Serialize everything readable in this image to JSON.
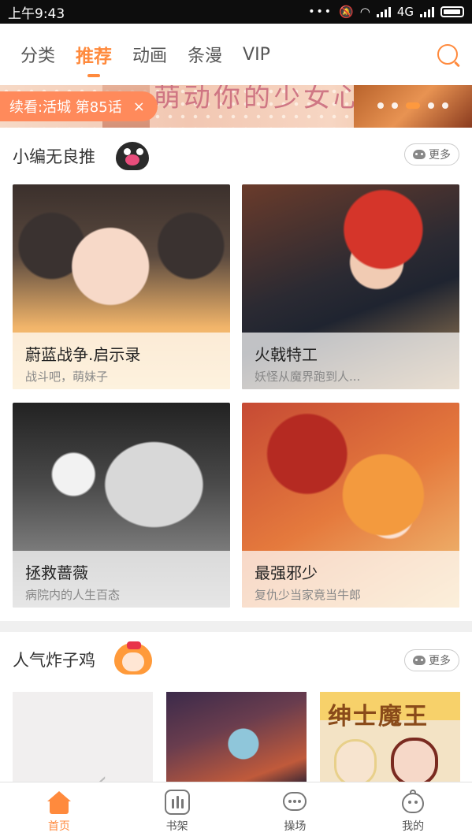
{
  "status_bar": {
    "time": "上午9:43",
    "network": "4G"
  },
  "top_nav": {
    "tabs": [
      {
        "label": "分类"
      },
      {
        "label": "推荐",
        "active": true
      },
      {
        "label": "动画"
      },
      {
        "label": "条漫"
      },
      {
        "label": "VIP"
      }
    ],
    "search_icon": "search-icon"
  },
  "banner": {
    "text": "萌动你的少女心",
    "resume_label": "续看:活城 第85话",
    "close_glyph": "×",
    "page_count": 5,
    "active_page": 3
  },
  "section_recommend": {
    "title": "小编无良推",
    "more_label": "更多",
    "cards": [
      {
        "title": "蔚蓝战争.启示录",
        "subtitle": "战斗吧，萌妹子"
      },
      {
        "title": "火戟特工",
        "subtitle": "妖怪从魔界跑到人..."
      },
      {
        "title": "拯救蔷薇",
        "subtitle": "病院内的人生百态"
      },
      {
        "title": "最强邪少",
        "subtitle": "复仇少当家竟当牛郎"
      }
    ]
  },
  "section_popular": {
    "title": "人气炸子鸡",
    "more_label": "更多",
    "thumb_3_logo": "绅士魔王"
  },
  "bottom_nav": {
    "items": [
      {
        "label": "首页",
        "icon": "home-icon",
        "active": true
      },
      {
        "label": "书架",
        "icon": "bookshelf-icon"
      },
      {
        "label": "操场",
        "icon": "chat-icon"
      },
      {
        "label": "我的",
        "icon": "profile-icon"
      }
    ]
  },
  "colors": {
    "accent": "#ff8a3d",
    "resume_bg": "#ff8a5b"
  }
}
